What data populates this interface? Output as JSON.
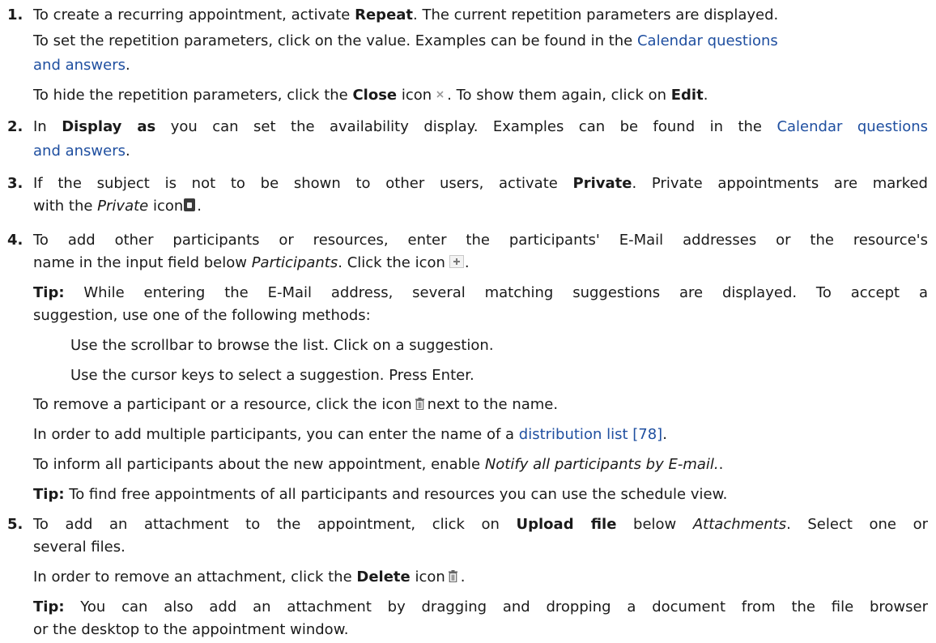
{
  "steps": [
    {
      "num": "1.",
      "l1a": "To create a recurring appointment, activate ",
      "l1b": "Repeat",
      "l1c": ". The current repetition parameters are displayed.",
      "l2a": "To set the repetition parameters, click on the value. Examples can be found in the ",
      "l2link": "Calendar questions",
      "l3link": "and answers",
      "l3b": ".",
      "l4a": "To hide the repetition parameters, click the ",
      "l4b": "Close",
      "l4c": " icon",
      "l4d": ". To show them again, click on ",
      "l4e": "Edit",
      "l4f": ".",
      "icon": "close-icon"
    },
    {
      "num": "2.",
      "l1a": "In ",
      "l1b": "Display as",
      "l1c": " you can set the availability display. Examples can be found in the ",
      "l1link": "Calendar questions",
      "l2link": "and answers",
      "l2b": "."
    },
    {
      "num": "3.",
      "l1a": "If the subject is not to be shown to other users, activate ",
      "l1b": "Private",
      "l1c": ". Private appointments are marked",
      "l2a": "with the ",
      "l2b": "Private",
      "l2c": " icon",
      "l2d": ".",
      "icon": "lock-icon"
    },
    {
      "num": "4.",
      "l1": "To add other participants or resources, enter the participants' E-Mail addresses or the resource's",
      "l2a": "name in the input field below ",
      "l2b": "Participants",
      "l2c": ". Click the icon",
      "l2d": ".",
      "tip1a": "Tip:",
      "tip1b": " While entering the E-Mail address, several matching suggestions are displayed. To accept a",
      "tip1c": "suggestion, use one of the following methods:",
      "method1": "Use the scrollbar to browse the list. Click on a suggestion.",
      "method2": "Use the cursor keys to select a suggestion. Press Enter.",
      "remove_a": "To remove a participant or a resource, click the icon",
      "remove_b": "next to the name.",
      "multi_a": "In order to add multiple participants, you can enter the name of a ",
      "multi_link": "distribution list [78]",
      "multi_b": ".",
      "inform_a": "To inform all participants about the new appointment, enable ",
      "inform_b": "Notify all participants by E-mail.",
      "inform_c": ".",
      "tip2a": "Tip:",
      "tip2b": " To find free appointments of all participants and resources you can use the schedule view.",
      "icons": [
        "plus-icon",
        "trash-icon"
      ]
    },
    {
      "num": "5.",
      "l1a": "To add an attachment to the appointment, click on ",
      "l1b": "Upload file",
      "l1c": " below ",
      "l1d": "Attachments",
      "l1e": ". Select one or",
      "l2": "several files.",
      "del_a": "In order to remove an attachment, click the ",
      "del_b": "Delete",
      "del_c": " icon",
      "del_d": ".",
      "tip_a": "Tip:",
      "tip_b": " You can also add an attachment by dragging and dropping a document from the file browser",
      "tip_c": "or the desktop to the appointment window.",
      "icon": "trash-icon"
    }
  ]
}
